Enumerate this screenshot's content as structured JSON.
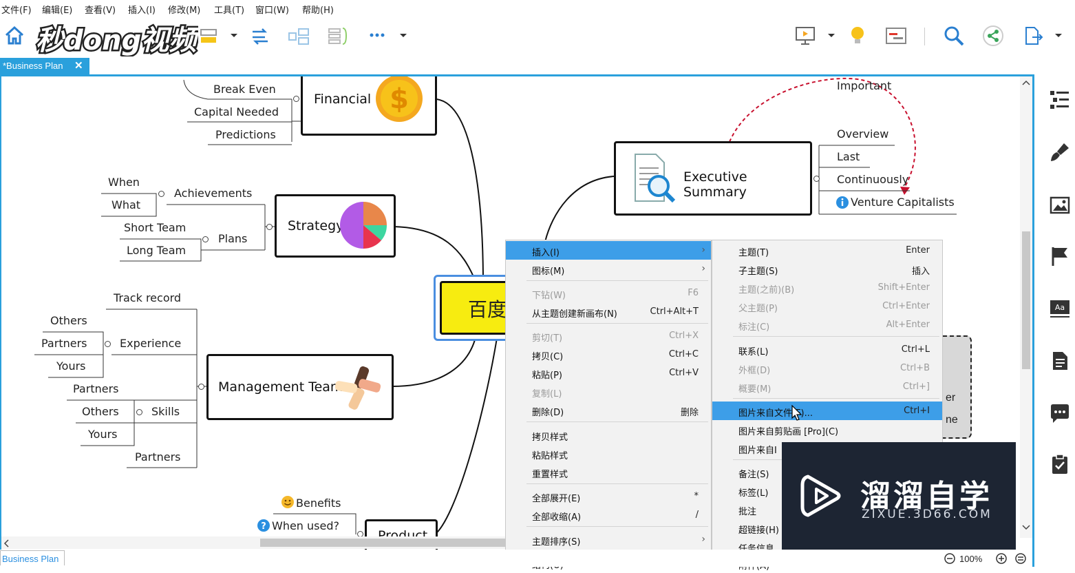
{
  "menubar": {
    "items": [
      "文件(F)",
      "编辑(E)",
      "查看(V)",
      "插入(I)",
      "修改(M)",
      "工具(T)",
      "窗口(W)",
      "帮助(H)"
    ]
  },
  "toolbar": {
    "logo_text": "秒dong视频",
    "icons": [
      "home-icon",
      "layout-icon",
      "dropdown-icon",
      "relationship-icon",
      "boundary-icon",
      "summary-icon",
      "more-icon",
      "dropdown-icon",
      "presentation-icon",
      "idea-icon",
      "gantt-icon",
      "search-icon",
      "share-icon",
      "export-icon"
    ]
  },
  "tabs": {
    "active_label": "*Business Plan",
    "close_glyph": "✕",
    "bottom_label": "Business Plan"
  },
  "mindmap": {
    "central_text": "百度",
    "financial": {
      "title": "Financial",
      "children": [
        "Break Even",
        "Capital Needed",
        "Predictions"
      ]
    },
    "strategy": {
      "title": "Strategy",
      "achievements": "Achievements",
      "plans": "Plans",
      "a_children": [
        "When",
        "What"
      ],
      "p_children": [
        "Short Team",
        "Long Team"
      ]
    },
    "management": {
      "title": "Management Team",
      "track": "Track record",
      "experience": "Experience",
      "skills": "Skills",
      "exp_children": [
        "Others",
        "Partners",
        "Yours"
      ],
      "skills_children": [
        "Partners",
        "Others",
        "Yours"
      ],
      "partners": "Partners"
    },
    "product": {
      "title": "Product",
      "benefits": "Benefits",
      "when_used": "When used?"
    },
    "executive": {
      "title": "Executive Summary",
      "important": "Important",
      "children": [
        "Overview",
        "Last",
        "Continuously",
        "Venture Capitalists"
      ]
    },
    "partial_right": [
      "er",
      "ne"
    ]
  },
  "context_menu": {
    "items": [
      {
        "label": "插入(I)",
        "key": "",
        "submenu": true,
        "disabled": false,
        "highlight": true
      },
      {
        "label": "图标(M)",
        "key": "",
        "submenu": true,
        "disabled": false,
        "highlight": false
      },
      {
        "label": "下钻(W)",
        "key": "F6",
        "submenu": false,
        "disabled": true,
        "highlight": false
      },
      {
        "label": "从主题创建新画布(N)",
        "key": "Ctrl+Alt+T",
        "submenu": false,
        "disabled": false,
        "highlight": false
      },
      {
        "label": "剪切(T)",
        "key": "Ctrl+X",
        "submenu": false,
        "disabled": true,
        "highlight": false
      },
      {
        "label": "拷贝(C)",
        "key": "Ctrl+C",
        "submenu": false,
        "disabled": false,
        "highlight": false
      },
      {
        "label": "粘贴(P)",
        "key": "Ctrl+V",
        "submenu": false,
        "disabled": false,
        "highlight": false
      },
      {
        "label": "复制(L)",
        "key": "",
        "submenu": false,
        "disabled": true,
        "highlight": false
      },
      {
        "label": "删除(D)",
        "key": "删除",
        "submenu": false,
        "disabled": false,
        "highlight": false
      },
      {
        "label": "拷贝样式",
        "key": "",
        "submenu": false,
        "disabled": false,
        "highlight": false
      },
      {
        "label": "粘贴样式",
        "key": "",
        "submenu": false,
        "disabled": false,
        "highlight": false
      },
      {
        "label": "重置样式",
        "key": "",
        "submenu": false,
        "disabled": false,
        "highlight": false
      },
      {
        "label": "全部展开(E)",
        "key": "*",
        "submenu": false,
        "disabled": false,
        "highlight": false
      },
      {
        "label": "全部收缩(A)",
        "key": "/",
        "submenu": false,
        "disabled": false,
        "highlight": false
      },
      {
        "label": "主题排序(S)",
        "key": "",
        "submenu": true,
        "disabled": false,
        "highlight": false
      },
      {
        "label": "结构(U)",
        "key": "",
        "submenu": true,
        "disabled": false,
        "highlight": false
      }
    ]
  },
  "submenu": {
    "items": [
      {
        "label": "主题(T)",
        "key": "Enter",
        "disabled": false,
        "highlight": false
      },
      {
        "label": "子主题(S)",
        "key": "插入",
        "disabled": false,
        "highlight": false
      },
      {
        "label": "主题(之前)(B)",
        "key": "Shift+Enter",
        "disabled": true,
        "highlight": false
      },
      {
        "label": "父主题(P)",
        "key": "Ctrl+Enter",
        "disabled": true,
        "highlight": false
      },
      {
        "label": "标注(C)",
        "key": "Alt+Enter",
        "disabled": true,
        "highlight": false
      },
      {
        "label": "联系(L)",
        "key": "Ctrl+L",
        "disabled": false,
        "highlight": false
      },
      {
        "label": "外框(D)",
        "key": "Ctrl+B",
        "disabled": true,
        "highlight": false
      },
      {
        "label": "概要(M)",
        "key": "Ctrl+]",
        "disabled": true,
        "highlight": false
      },
      {
        "label": "图片来自文件(F)...",
        "key": "Ctrl+I",
        "disabled": false,
        "highlight": true
      },
      {
        "label": "图片来自剪贴画 [Pro](C)",
        "key": "",
        "disabled": false,
        "highlight": false
      },
      {
        "label": "图片来自I",
        "key": "",
        "disabled": false,
        "highlight": false
      },
      {
        "label": "备注(S)",
        "key": "",
        "disabled": false,
        "highlight": false
      },
      {
        "label": "标签(L)",
        "key": "",
        "disabled": false,
        "highlight": false
      },
      {
        "label": "批注",
        "key": "",
        "disabled": false,
        "highlight": false
      },
      {
        "label": "超链接(H)",
        "key": "",
        "disabled": false,
        "highlight": false
      },
      {
        "label": "任务信息",
        "key": "",
        "disabled": false,
        "highlight": false
      },
      {
        "label": "附件(A)",
        "key": "",
        "disabled": false,
        "highlight": false
      }
    ]
  },
  "watermark": {
    "title": "溜溜自学",
    "subtitle": "ZIXUE.3D66.COM"
  },
  "statusbar": {
    "zoom": "100%"
  },
  "colors": {
    "accent": "#2aa0dc",
    "central_fill": "#f7ec10",
    "menu_highlight": "#3d9ee8",
    "relationship": "#c8102e"
  }
}
